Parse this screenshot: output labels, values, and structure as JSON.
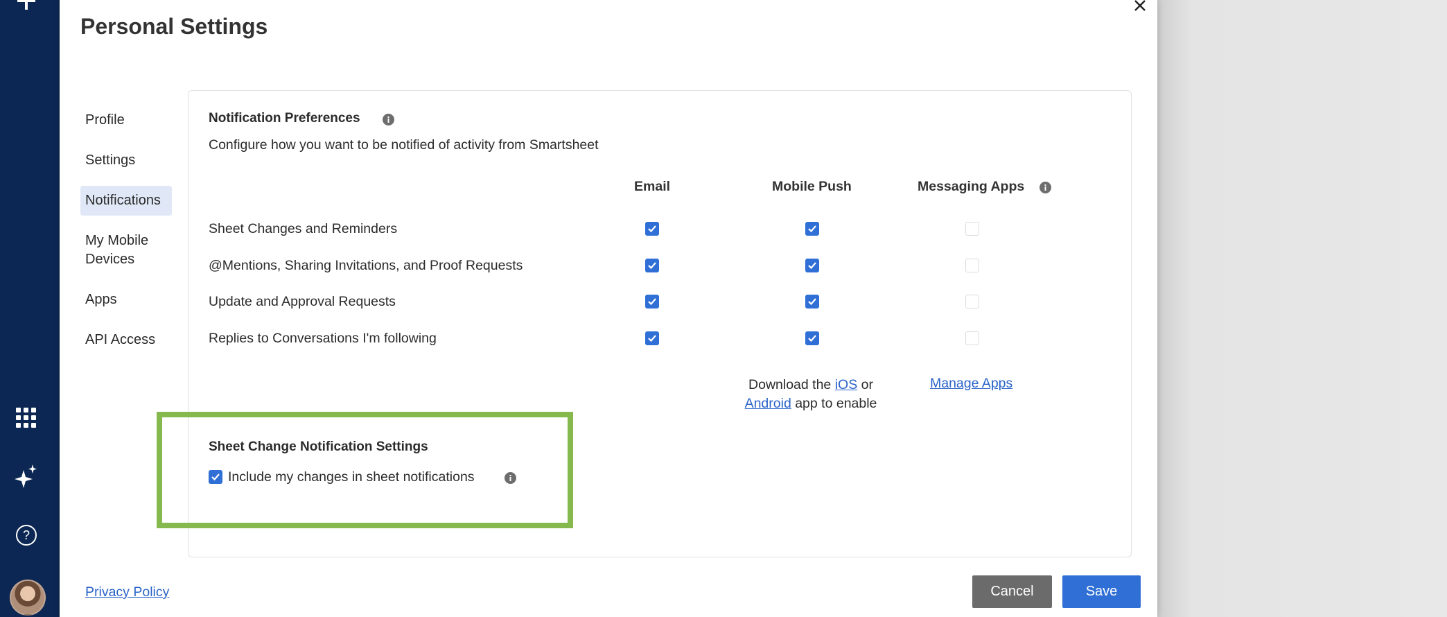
{
  "dialog": {
    "title": "Personal Settings"
  },
  "nav": {
    "items": [
      {
        "label": "Profile"
      },
      {
        "label": "Settings"
      },
      {
        "label": "Notifications",
        "active": true
      },
      {
        "label": "My Mobile Devices"
      },
      {
        "label": "Apps"
      },
      {
        "label": "API Access"
      }
    ]
  },
  "notification_preferences": {
    "title": "Notification Preferences",
    "description": "Configure how you want to be notified of activity from Smartsheet",
    "columns": [
      "Email",
      "Mobile Push",
      "Messaging Apps"
    ],
    "rows": [
      {
        "label": "Sheet Changes and Reminders",
        "email": true,
        "mobile_push": true,
        "messaging_apps": false
      },
      {
        "label": "@Mentions, Sharing Invitations, and Proof Requests",
        "email": true,
        "mobile_push": true,
        "messaging_apps": false
      },
      {
        "label": "Update and Approval Requests",
        "email": true,
        "mobile_push": true,
        "messaging_apps": false
      },
      {
        "label": "Replies to Conversations I'm following",
        "email": true,
        "mobile_push": true,
        "messaging_apps": false
      }
    ],
    "download_note": {
      "prefix": "Download the ",
      "ios_link": "iOS",
      "middle": " or",
      "android_link": "Android",
      "suffix": " app to enable"
    },
    "manage_apps_link": "Manage Apps"
  },
  "sheet_change": {
    "title": "Sheet Change Notification Settings",
    "checkbox_label": "Include my changes in sheet notifications",
    "checked": true
  },
  "footer": {
    "privacy_link": "Privacy Policy",
    "cancel_label": "Cancel",
    "save_label": "Save"
  },
  "colors": {
    "accent": "#2f6fd6",
    "sidebar": "#0c2753",
    "highlight_border": "#85b84d",
    "cancel_button": "#6b6b6b"
  },
  "icons": {
    "close": "close-icon",
    "info": "info-icon",
    "checkmark": "checkmark-icon",
    "plus": "plus-icon",
    "apps_grid": "apps-grid-icon",
    "ai_sparkle": "sparkle-icon",
    "help": "help-icon"
  }
}
